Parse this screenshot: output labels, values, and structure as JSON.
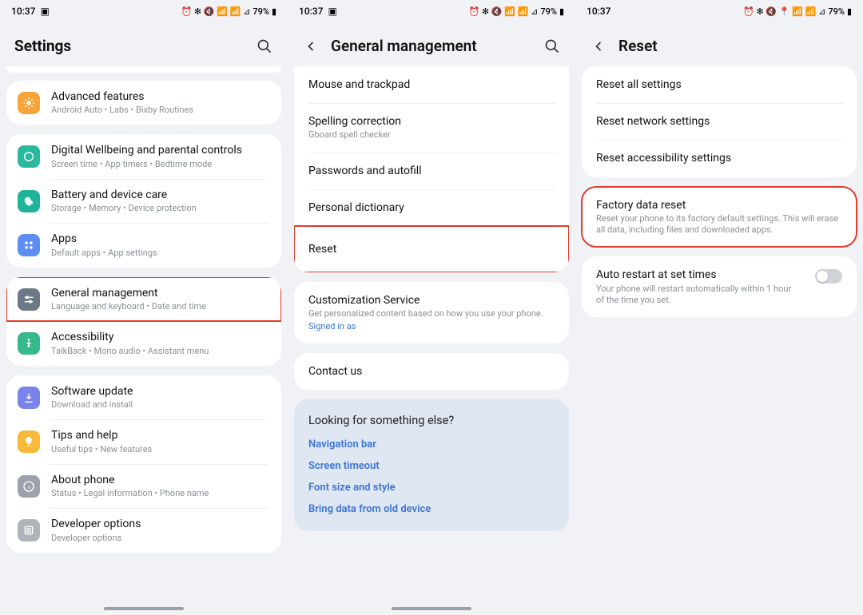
{
  "status": {
    "time": "10:37",
    "battery": "79%"
  },
  "pane1": {
    "title": "Settings",
    "items": [
      {
        "title": "Advanced features",
        "sub": "Android Auto  •  Labs  •  Bixby Routines",
        "color": "#f7a43b",
        "icon": "star"
      },
      {
        "title": "Digital Wellbeing and parental controls",
        "sub": "Screen time  •  App timers  •  Bedtime mode",
        "color": "#2ab89f",
        "icon": "wellbeing"
      },
      {
        "title": "Battery and device care",
        "sub": "Storage  •  Memory  •  Device protection",
        "color": "#1fb497",
        "icon": "care"
      },
      {
        "title": "Apps",
        "sub": "Default apps  •  App settings",
        "color": "#5b8ef0",
        "icon": "apps"
      },
      {
        "title": "General management",
        "sub": "Language and keyboard  •  Date and time",
        "color": "#6b7885",
        "icon": "general"
      },
      {
        "title": "Accessibility",
        "sub": "TalkBack  •  Mono audio  •  Assistant menu",
        "color": "#36b889",
        "icon": "accessibility"
      },
      {
        "title": "Software update",
        "sub": "Download and install",
        "color": "#7a83ea",
        "icon": "update"
      },
      {
        "title": "Tips and help",
        "sub": "Useful tips  •  New features",
        "color": "#f6b93c",
        "icon": "tips"
      },
      {
        "title": "About phone",
        "sub": "Status  •  Legal information  •  Phone name",
        "color": "#9ba2ab",
        "icon": "about"
      },
      {
        "title": "Developer options",
        "sub": "Developer options",
        "color": "#aeb4bc",
        "icon": "dev"
      }
    ]
  },
  "pane2": {
    "title": "General management",
    "group1": [
      {
        "title": "Mouse and trackpad"
      },
      {
        "title": "Spelling correction",
        "sub": "Gboard spell checker"
      },
      {
        "title": "Passwords and autofill"
      },
      {
        "title": "Personal dictionary"
      },
      {
        "title": "Reset"
      }
    ],
    "customization": {
      "title": "Customization Service",
      "sub": "Get personalized content based on how you use your phone.",
      "status": "Signed in as"
    },
    "contact": "Contact us",
    "looking": {
      "heading": "Looking for something else?",
      "links": [
        "Navigation bar",
        "Screen timeout",
        "Font size and style",
        "Bring data from old device"
      ]
    }
  },
  "pane3": {
    "title": "Reset",
    "group1": [
      {
        "title": "Reset all settings"
      },
      {
        "title": "Reset network settings"
      },
      {
        "title": "Reset accessibility settings"
      }
    ],
    "factory": {
      "title": "Factory data reset",
      "sub": "Reset your phone to its factory default settings. This will erase all data, including files and downloaded apps."
    },
    "auto": {
      "title": "Auto restart at set times",
      "sub": "Your phone will restart automatically within 1 hour of the time you set."
    }
  }
}
